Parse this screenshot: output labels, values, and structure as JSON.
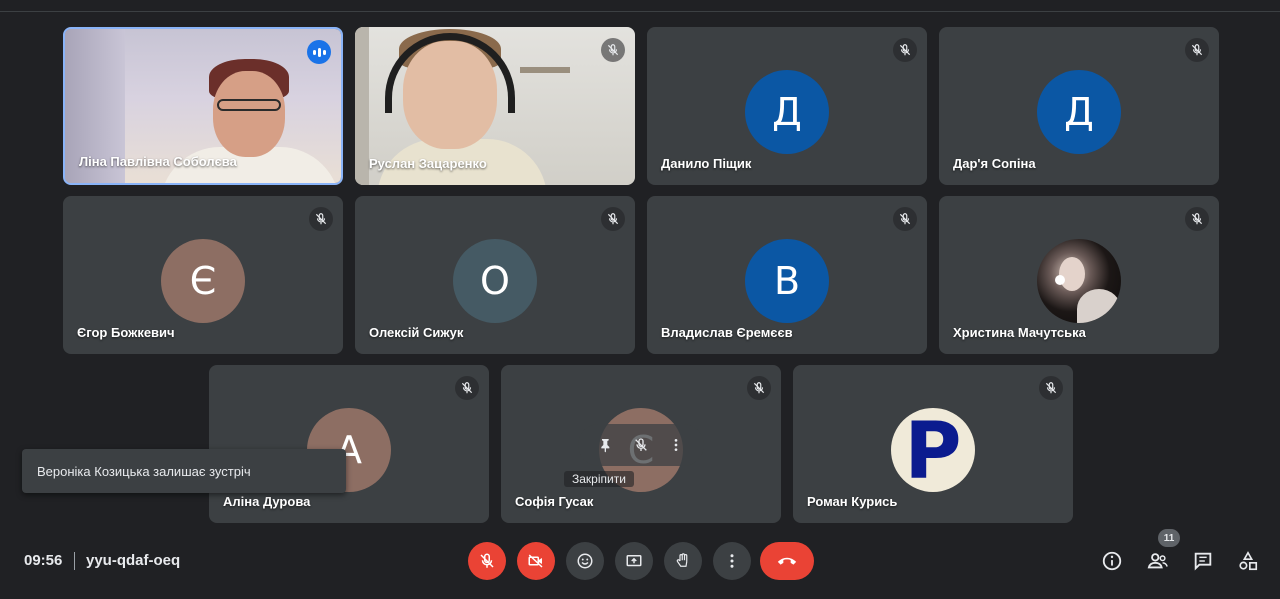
{
  "meeting": {
    "time": "09:56",
    "code": "yyu-qdaf-oeq",
    "participants_count": "11"
  },
  "notification": {
    "text": "Вероніка Козицька залишає зустріч"
  },
  "tile_menu": {
    "pin_label": "Закріпити"
  },
  "participants": [
    {
      "name": "Ліна Павлівна Соболєва",
      "state": "video",
      "speaking": true
    },
    {
      "name": "Руслан Зацаренко",
      "state": "video",
      "muted": true
    },
    {
      "name": "Данило Піщик",
      "initial": "Д",
      "color": "#0b57a4",
      "muted": true
    },
    {
      "name": "Дар'я Сопіна",
      "initial": "Д",
      "color": "#0b57a4",
      "muted": true
    },
    {
      "name": "Єгор Божкевич",
      "initial": "Є",
      "color": "#8d6e63",
      "muted": true
    },
    {
      "name": "Олексій Сижук",
      "initial": "О",
      "color": "#455a64",
      "muted": true
    },
    {
      "name": "Владислав Єремєєв",
      "initial": "В",
      "color": "#0b57a4",
      "muted": true
    },
    {
      "name": "Христина Мачутська",
      "state": "photo",
      "muted": true
    },
    {
      "name": "Аліна Дурова",
      "initial": "А",
      "color": "#8d6e63",
      "muted": true
    },
    {
      "name": "Софія Гусак",
      "initial": "С",
      "color": "#8d6e63",
      "muted": true
    },
    {
      "name": "Роман Курись",
      "initial": "P",
      "color": "#f0ead9",
      "muted": true
    }
  ],
  "icons": {
    "mute": "mic-off-icon",
    "camera": "camera-off-icon",
    "emoji": "emoji-icon",
    "present": "present-icon",
    "hand": "raise-hand-icon",
    "more": "more-vert-icon",
    "end": "call-end-icon",
    "info": "info-icon",
    "people": "people-icon",
    "chat": "chat-icon",
    "activities": "activities-icon"
  },
  "colors": {
    "background": "#202124",
    "tile": "#3c4043",
    "danger": "#ea4335",
    "active_border": "#8ab4f8"
  }
}
